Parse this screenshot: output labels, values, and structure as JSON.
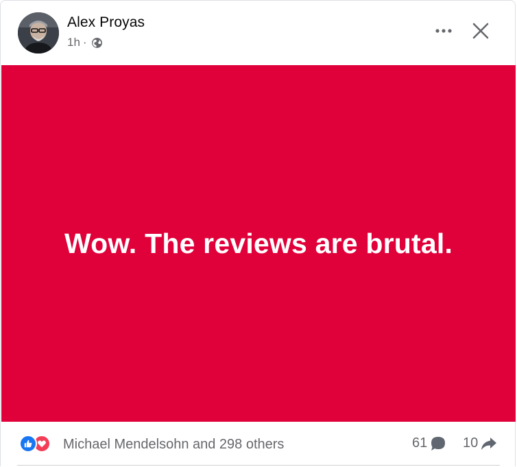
{
  "post": {
    "author": "Alex Proyas",
    "time": "1h",
    "separator": "·",
    "audience_icon": "globe-icon",
    "text": "Wow. The reviews are brutal.",
    "background_color": "#e0003a",
    "text_color": "#ffffff"
  },
  "footer": {
    "reaction_icons": [
      "like-icon",
      "love-icon"
    ],
    "reactions_text": "Michael Mendelsohn and 298 others",
    "comments_count": "61",
    "shares_count": "10"
  },
  "colors": {
    "like_blue": "#1877f2",
    "love_red": "#f33e58",
    "secondary_text": "#65676b"
  }
}
